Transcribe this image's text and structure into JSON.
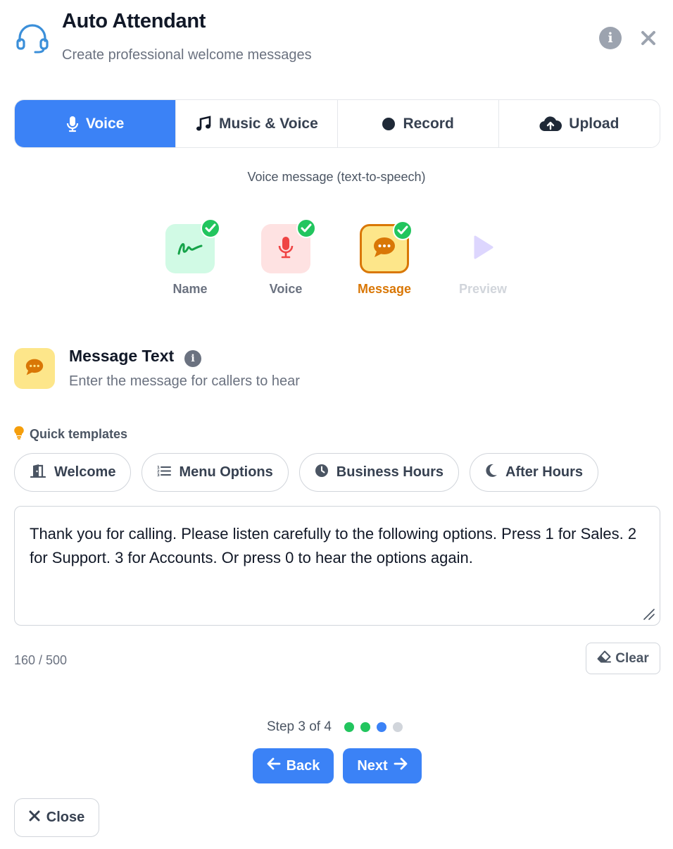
{
  "header": {
    "title": "Auto Attendant",
    "subtitle": "Create professional welcome messages",
    "icon": "headset-icon",
    "info_icon": "info-icon",
    "close_icon": "close-icon"
  },
  "tabs": [
    {
      "label": "Voice",
      "icon": "microphone-icon",
      "active": true
    },
    {
      "label": "Music & Voice",
      "icon": "music-note-icon",
      "active": false
    },
    {
      "label": "Record",
      "icon": "record-dot-icon",
      "active": false
    },
    {
      "label": "Upload",
      "icon": "cloud-upload-icon",
      "active": false
    }
  ],
  "mode_caption": "Voice message (text-to-speech)",
  "steps": [
    {
      "label": "Name",
      "icon": "signature-icon",
      "completed": true,
      "current": false
    },
    {
      "label": "Voice",
      "icon": "microphone-icon",
      "completed": true,
      "current": false
    },
    {
      "label": "Message",
      "icon": "chat-bubble-icon",
      "completed": true,
      "current": true
    },
    {
      "label": "Preview",
      "icon": "play-icon",
      "completed": false,
      "current": false
    }
  ],
  "section": {
    "title": "Message Text",
    "subtitle": "Enter the message for callers to hear",
    "icon": "chat-bubble-icon"
  },
  "quick_templates": {
    "label": "Quick templates",
    "icon": "lightbulb-icon",
    "items": [
      {
        "label": "Welcome",
        "icon": "door-icon"
      },
      {
        "label": "Menu Options",
        "icon": "list-icon"
      },
      {
        "label": "Business Hours",
        "icon": "clock-icon"
      },
      {
        "label": "After Hours",
        "icon": "moon-icon"
      }
    ]
  },
  "message": {
    "value": "Thank you for calling. Please listen carefully to the following options. Press 1 for Sales. 2 for Support. 3 for Accounts. Or press 0 to hear the options again."
  },
  "counter": "160 / 500",
  "clear_label": "Clear",
  "progress": {
    "label": "Step 3 of 4",
    "current": 3,
    "total": 4
  },
  "nav": {
    "back_label": "Back",
    "next_label": "Next",
    "close_label": "Close"
  },
  "colors": {
    "primary": "#3b82f6",
    "success": "#22c55e",
    "accent_orange": "#d97706",
    "inactive_dot": "#d1d5db"
  }
}
